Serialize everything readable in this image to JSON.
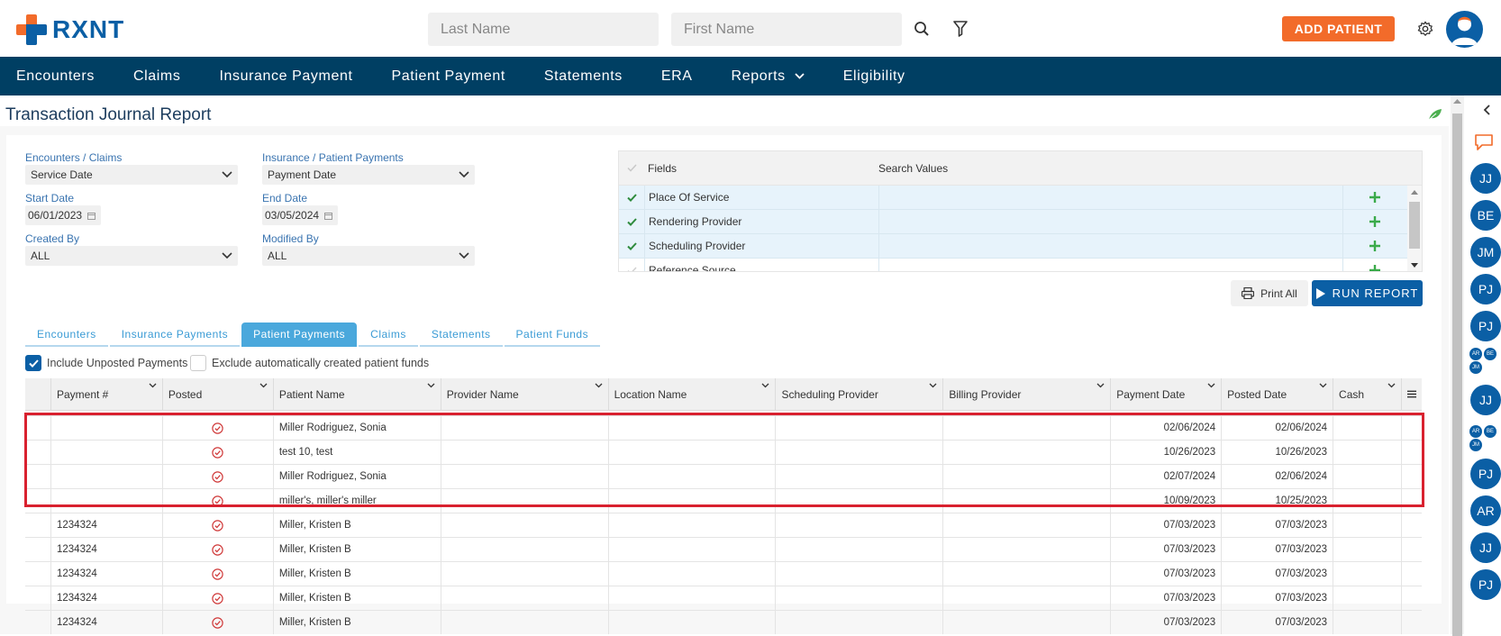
{
  "app": {
    "logo_text": "RXNT",
    "search": {
      "last_name_placeholder": "Last Name",
      "first_name_placeholder": "First Name"
    },
    "add_patient_label": "ADD PATIENT"
  },
  "nav": {
    "items": [
      "Encounters",
      "Claims",
      "Insurance Payment",
      "Patient Payment",
      "Statements",
      "ERA",
      "Reports",
      "Eligibility"
    ]
  },
  "page": {
    "title": "Transaction Journal Report"
  },
  "filters": {
    "encounters_claims_label": "Encounters / Claims",
    "encounters_claims_value": "Service Date",
    "ins_patient_label": "Insurance / Patient Payments",
    "ins_patient_value": "Payment Date",
    "start_date_label": "Start Date",
    "start_date_value": "06/01/2023",
    "end_date_label": "End Date",
    "end_date_value": "03/05/2024",
    "created_by_label": "Created By",
    "created_by_value": "ALL",
    "modified_by_label": "Modified By",
    "modified_by_value": "ALL"
  },
  "fields_grid": {
    "header_fields": "Fields",
    "header_search_values": "Search Values",
    "rows": [
      {
        "name": "Place Of Service",
        "checked": true
      },
      {
        "name": "Rendering Provider",
        "checked": true
      },
      {
        "name": "Scheduling Provider",
        "checked": true
      },
      {
        "name": "Reference Source",
        "checked": false
      }
    ]
  },
  "actions": {
    "print_all": "Print All",
    "run_report": "RUN REPORT"
  },
  "tabs": [
    "Encounters",
    "Insurance Payments",
    "Patient Payments",
    "Claims",
    "Statements",
    "Patient Funds"
  ],
  "active_tab": "Patient Payments",
  "options": {
    "include_unposted": "Include Unposted Payments",
    "exclude_auto_funds": "Exclude automatically created patient funds"
  },
  "grid": {
    "columns": [
      "Payment #",
      "Posted",
      "Patient Name",
      "Provider Name",
      "Location Name",
      "Scheduling Provider",
      "Billing Provider",
      "Payment Date",
      "Posted Date",
      "Cash"
    ],
    "rows": [
      {
        "payment": "",
        "patient": "Miller Rodriguez, Sonia",
        "payment_date": "02/06/2024",
        "posted_date": "02/06/2024"
      },
      {
        "payment": "",
        "patient": "test 10, test",
        "payment_date": "10/26/2023",
        "posted_date": "10/26/2023"
      },
      {
        "payment": "",
        "patient": "Miller Rodriguez, Sonia",
        "payment_date": "02/07/2024",
        "posted_date": "02/06/2024"
      },
      {
        "payment": "",
        "patient": "miller's, miller's miller",
        "payment_date": "10/09/2023",
        "posted_date": "10/25/2023"
      },
      {
        "payment": "1234324",
        "patient": "Miller, Kristen B",
        "payment_date": "07/03/2023",
        "posted_date": "07/03/2023"
      },
      {
        "payment": "1234324",
        "patient": "Miller, Kristen B",
        "payment_date": "07/03/2023",
        "posted_date": "07/03/2023"
      },
      {
        "payment": "1234324",
        "patient": "Miller, Kristen B",
        "payment_date": "07/03/2023",
        "posted_date": "07/03/2023"
      },
      {
        "payment": "1234324",
        "patient": "Miller, Kristen B",
        "payment_date": "07/03/2023",
        "posted_date": "07/03/2023"
      },
      {
        "payment": "1234324",
        "patient": "Miller, Kristen B",
        "payment_date": "07/03/2023",
        "posted_date": "07/03/2023"
      }
    ]
  },
  "rail": {
    "avatars": [
      "JJ",
      "BE",
      "JM",
      "PJ",
      "PJ",
      "JJ",
      "PJ",
      "AR",
      "JJ",
      "PJ"
    ],
    "mini_group_1": [
      "AR",
      "BE",
      "JM"
    ],
    "mini_group_2": [
      "AR",
      "BE",
      "JM"
    ]
  },
  "colors": {
    "brand_blue": "#0b5fa5",
    "brand_orange": "#f26b2a",
    "nav_bg": "#003f63",
    "highlight_red": "#d9212f"
  }
}
